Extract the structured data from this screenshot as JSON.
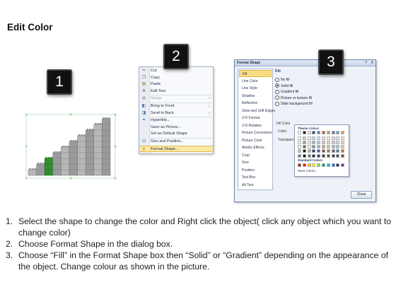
{
  "title": "Edit Color",
  "badges": [
    "1",
    "2",
    "3"
  ],
  "context_menu": {
    "items": [
      {
        "label": "Cut",
        "icon": "scissors-icon",
        "glyph": "✂",
        "color": "#556"
      },
      {
        "label": "Copy",
        "icon": "copy-icon",
        "glyph": "❐",
        "color": "#557"
      },
      {
        "label": "Paste",
        "icon": "paste-icon",
        "glyph": "▤",
        "color": "#a06a1c"
      },
      {
        "label": "Edit Text",
        "icon": "edit-text-icon",
        "glyph": "A",
        "color": "#333"
      },
      {
        "label": "Group",
        "icon": "group-icon",
        "glyph": "▣",
        "color": "#aaa",
        "disabled": true,
        "submenu": true
      },
      {
        "label": "Bring to Front",
        "icon": "bring-to-front-icon",
        "glyph": "◧",
        "color": "#3d66a8",
        "submenu": true
      },
      {
        "label": "Send to Back",
        "icon": "send-to-back-icon",
        "glyph": "◨",
        "color": "#3d66a8",
        "submenu": true
      },
      {
        "label": "Hyperlink...",
        "icon": "hyperlink-icon",
        "glyph": "⚭",
        "color": "#2a5aa0"
      },
      {
        "label": "Save as Picture...",
        "icon": "",
        "glyph": "",
        "color": "#333"
      },
      {
        "label": "Set as Default Shape",
        "icon": "",
        "glyph": "",
        "color": "#333"
      },
      {
        "label": "Size and Position...",
        "icon": "size-position-icon",
        "glyph": "⊡",
        "color": "#3d66a8"
      },
      {
        "label": "Format Shape...",
        "icon": "format-shape-icon",
        "glyph": "◈",
        "color": "#d0a020",
        "highlighted": true
      }
    ]
  },
  "format_dialog": {
    "title": "Format Shape",
    "help": "?",
    "close_x": "X",
    "categories": [
      "Fill",
      "Line Color",
      "Line Style",
      "Shadow",
      "Reflection",
      "Glow and Soft Edges",
      "3-D Format",
      "3-D Rotation",
      "Picture Corrections",
      "Picture Color",
      "Artistic Effects",
      "Crop",
      "Size",
      "Position",
      "Text Box",
      "Alt Text"
    ],
    "selected_category": "Fill",
    "pane_heading": "Fill",
    "fill_options": [
      {
        "label": "No fill",
        "checked": false
      },
      {
        "label": "Solid fill",
        "checked": true
      },
      {
        "label": "Gradient fill",
        "checked": false
      },
      {
        "label": "Picture or texture fill",
        "checked": false
      },
      {
        "label": "Slide background fill",
        "checked": false
      }
    ],
    "fill_color_heading": "Fill Color",
    "color_label": "Color:",
    "transparency_label": "Transparency:",
    "close_button": "Close",
    "accent_color": "#1f497d"
  },
  "palette": {
    "theme_heading": "Theme Colors",
    "standard_heading": "Standard Colors",
    "more_colors": "More Colors...",
    "theme_top": [
      "#ffffff",
      "#000000",
      "#eeece1",
      "#1f497d",
      "#4f81bd",
      "#c0504d",
      "#9bbb59",
      "#8064a2",
      "#4bacc6",
      "#f79646"
    ],
    "standard": [
      "#c00000",
      "#ff0000",
      "#ffc000",
      "#ffff00",
      "#92d050",
      "#00b050",
      "#00b0f0",
      "#0070c0",
      "#002060",
      "#7030a0"
    ]
  },
  "instructions": [
    {
      "num": "1.",
      "text": "Select the shape to change the color and Right click the object( click any object which you want to change color)"
    },
    {
      "num": "2.",
      "text": "Choose Format Shape in the dialog box."
    },
    {
      "num": "3.",
      "text": "Choose “Fill” in the Format Shape box then “Solid” or “Gradient” depending on the appearance of the object. Change colour as shown in the picture."
    }
  ]
}
